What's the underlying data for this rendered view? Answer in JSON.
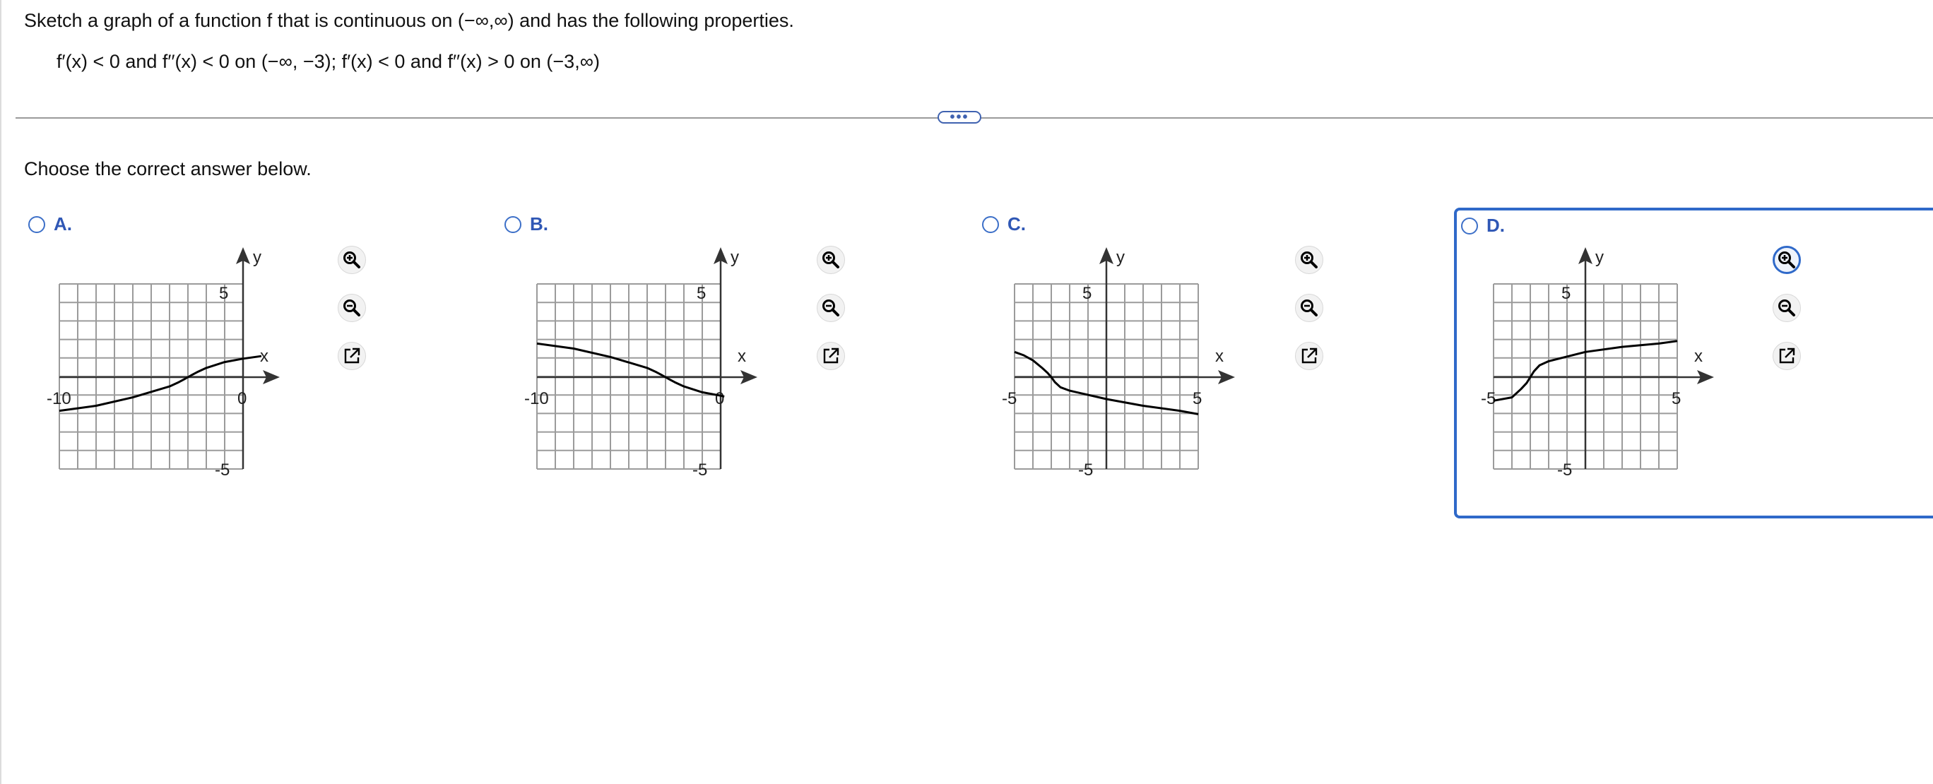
{
  "question": {
    "prompt": "Sketch a graph of a function f that is continuous on (−∞,∞) and has the following properties.",
    "properties": "f′(x) < 0 and f′′(x) < 0 on (−∞, −3); f′(x) < 0 and f′′(x) > 0 on (−3,∞)"
  },
  "more_button_label": "•••",
  "instruction": "Choose the correct answer below.",
  "colors": {
    "accent": "#2f69c9",
    "letter": "#2f57b5",
    "grid": "#9b9b9b",
    "curve": "#000000"
  },
  "options": [
    {
      "letter": "A.",
      "selected": false,
      "chart_data": {
        "type": "line",
        "xlim": [
          -10,
          1
        ],
        "ylim": [
          -6,
          6
        ],
        "xlabel": "x",
        "ylabel": "y",
        "xticks_labeled": [
          "-10",
          "0"
        ],
        "yticks_labeled": [
          "5",
          "-5"
        ],
        "grid": true,
        "points": [
          [
            -10,
            -2
          ],
          [
            -8,
            -1.7
          ],
          [
            -6,
            -1.2
          ],
          [
            -4,
            -0.55
          ],
          [
            -3.5,
            -0.3
          ],
          [
            -3.2,
            -0.12
          ],
          [
            -3,
            0
          ],
          [
            -2.8,
            0.12
          ],
          [
            -2.5,
            0.3
          ],
          [
            -2,
            0.55
          ],
          [
            -1,
            0.9
          ],
          [
            0,
            1.1
          ],
          [
            1,
            1.25
          ]
        ]
      }
    },
    {
      "letter": "B.",
      "selected": false,
      "chart_data": {
        "type": "line",
        "xlim": [
          -10,
          1
        ],
        "ylim": [
          -6,
          6
        ],
        "xlabel": "x",
        "ylabel": "y",
        "xticks_labeled": [
          "-10",
          "0"
        ],
        "yticks_labeled": [
          "5",
          "-5"
        ],
        "grid": true,
        "points": [
          [
            -10,
            2
          ],
          [
            -8,
            1.7
          ],
          [
            -6,
            1.2
          ],
          [
            -4,
            0.55
          ],
          [
            -3.5,
            0.3
          ],
          [
            -3.2,
            0.12
          ],
          [
            -3,
            0
          ],
          [
            -2.8,
            -0.12
          ],
          [
            -2.5,
            -0.3
          ],
          [
            -2,
            -0.55
          ],
          [
            -1,
            -0.9
          ],
          [
            0,
            -1.1
          ],
          [
            0.2,
            -1.15
          ]
        ]
      }
    },
    {
      "letter": "C.",
      "selected": false,
      "chart_data": {
        "type": "line",
        "xlim": [
          -5,
          5
        ],
        "ylim": [
          -6,
          6
        ],
        "xlabel": "x",
        "ylabel": "y",
        "xticks_labeled": [
          "-5",
          "5"
        ],
        "yticks_labeled": [
          "5",
          "-5"
        ],
        "grid": true,
        "points": [
          [
            -5,
            1.5
          ],
          [
            -4.5,
            1.3
          ],
          [
            -4,
            1
          ],
          [
            -3.5,
            0.55
          ],
          [
            -3.2,
            0.25
          ],
          [
            -3,
            0
          ],
          [
            -2.8,
            -0.3
          ],
          [
            -2.5,
            -0.6
          ],
          [
            -2,
            -0.8
          ],
          [
            0,
            -1.3
          ],
          [
            2,
            -1.7
          ],
          [
            4,
            -2
          ],
          [
            5,
            -2.2
          ]
        ]
      }
    },
    {
      "letter": "D.",
      "selected": true,
      "chart_data": {
        "type": "line",
        "xlim": [
          -5,
          5
        ],
        "ylim": [
          -6,
          6
        ],
        "xlabel": "x",
        "ylabel": "y",
        "xticks_labeled": [
          "-5",
          "5"
        ],
        "yticks_labeled": [
          "5",
          "-5"
        ],
        "grid": true,
        "points": [
          [
            -5,
            -1.4
          ],
          [
            -4,
            -1.2
          ],
          [
            -3.5,
            -0.7
          ],
          [
            -3.2,
            -0.35
          ],
          [
            -3,
            0
          ],
          [
            -2.8,
            0.35
          ],
          [
            -2.5,
            0.7
          ],
          [
            -2,
            0.95
          ],
          [
            0,
            1.5
          ],
          [
            2,
            1.8
          ],
          [
            4,
            2
          ],
          [
            5,
            2.15
          ]
        ]
      }
    }
  ],
  "tools": {
    "zoom_in": "zoom-in",
    "zoom_out": "zoom-out",
    "popout": "open-in-new-window"
  }
}
